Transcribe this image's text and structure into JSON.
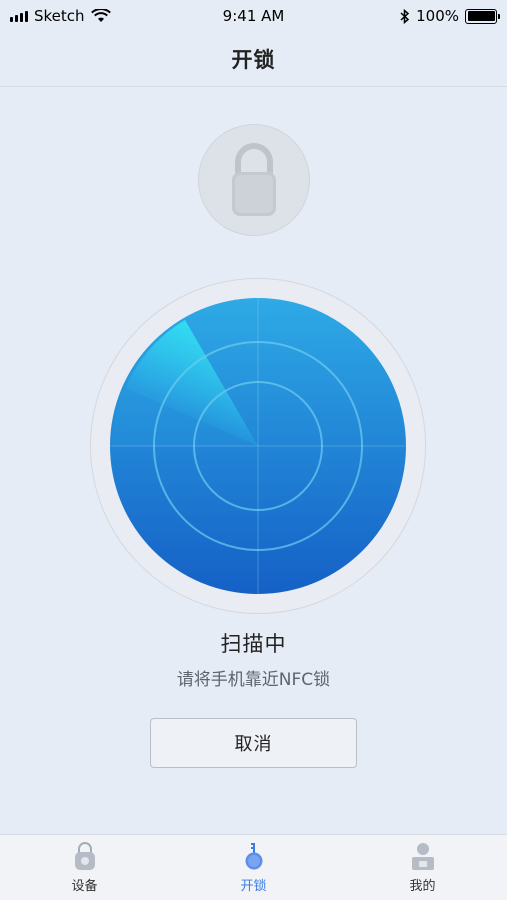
{
  "status_bar": {
    "carrier": "Sketch",
    "time": "9:41 AM",
    "battery": "100%"
  },
  "nav": {
    "title": "开锁"
  },
  "scan": {
    "title": "扫描中",
    "hint": "请将手机靠近NFC锁"
  },
  "actions": {
    "cancel_label": "取消"
  },
  "tabs": [
    {
      "label": "设备",
      "icon": "lock-icon",
      "active": false
    },
    {
      "label": "开锁",
      "icon": "key-icon",
      "active": true
    },
    {
      "label": "我的",
      "icon": "user-icon",
      "active": false
    }
  ],
  "colors": {
    "accent": "#3a7be4",
    "radar_light": "#29b6ea",
    "radar_dark": "#1565c8"
  }
}
